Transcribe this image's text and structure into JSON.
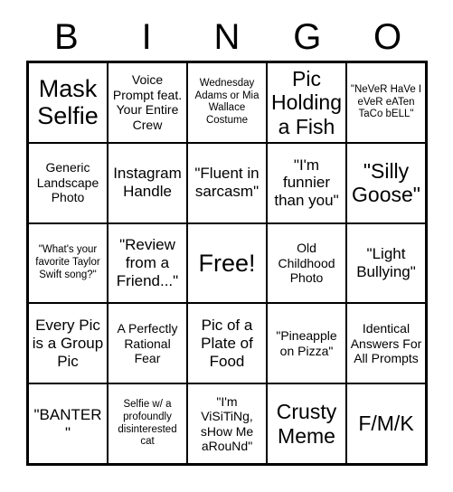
{
  "header": {
    "letters": [
      "B",
      "I",
      "N",
      "G",
      "O"
    ]
  },
  "grid": {
    "rows": [
      [
        {
          "text": "Mask Selfie",
          "size": "sz-xl"
        },
        {
          "text": "Voice Prompt feat. Your Entire Crew",
          "size": "sz-sm"
        },
        {
          "text": "Wednesday Adams or Mia Wallace Costume",
          "size": "sz-xs"
        },
        {
          "text": "Pic Holding a Fish",
          "size": "sz-lg"
        },
        {
          "text": "\"NeVeR HaVe I eVeR eATen TaCo bELL\"",
          "size": "sz-xs"
        }
      ],
      [
        {
          "text": "Generic Landscape Photo",
          "size": "sz-sm"
        },
        {
          "text": "Instagram Handle",
          "size": "sz-md"
        },
        {
          "text": "\"Fluent in sarcasm\"",
          "size": "sz-md"
        },
        {
          "text": "\"I'm funnier than you\"",
          "size": "sz-md"
        },
        {
          "text": "\"Silly Goose\"",
          "size": "sz-lg"
        }
      ],
      [
        {
          "text": "\"What's your favorite Taylor Swift song?\"",
          "size": "sz-xs"
        },
        {
          "text": "\"Review from a Friend...\"",
          "size": "sz-md"
        },
        {
          "text": "Free!",
          "size": "sz-xl"
        },
        {
          "text": "Old Childhood Photo",
          "size": "sz-sm"
        },
        {
          "text": "\"Light Bullying\"",
          "size": "sz-md"
        }
      ],
      [
        {
          "text": "Every Pic is a Group Pic",
          "size": "sz-md"
        },
        {
          "text": "A Perfectly Rational Fear",
          "size": "sz-sm"
        },
        {
          "text": "Pic of a Plate of Food",
          "size": "sz-md"
        },
        {
          "text": "\"Pineapple on Pizza\"",
          "size": "sz-sm"
        },
        {
          "text": "Identical Answers For All Prompts",
          "size": "sz-sm"
        }
      ],
      [
        {
          "text": "\"BANTER\"",
          "size": "sz-md"
        },
        {
          "text": "Selfie w/ a profoundly disinterested cat",
          "size": "sz-xs"
        },
        {
          "text": "\"I'm ViSiTiNg, sHow Me aRouNd\"",
          "size": "sz-sm"
        },
        {
          "text": "Crusty Meme",
          "size": "sz-lg"
        },
        {
          "text": "F/M/K",
          "size": "sz-lg"
        }
      ]
    ]
  }
}
